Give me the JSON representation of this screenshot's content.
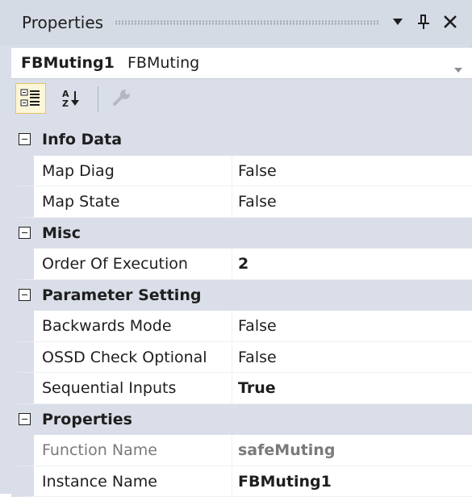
{
  "titlebar": {
    "title": "Properties",
    "icons": [
      "dropdown-arrow-icon",
      "pin-icon",
      "close-icon"
    ]
  },
  "selector": {
    "name": "FBMuting1",
    "type": "FBMuting"
  },
  "toolbar": {
    "tools": [
      "categorized-icon",
      "alphabetical-icon",
      "property-pages-icon"
    ],
    "active": "categorized"
  },
  "categories": [
    {
      "label": "Info Data",
      "properties": [
        {
          "name": "Map Diag",
          "value": "False"
        },
        {
          "name": "Map State",
          "value": "False"
        }
      ]
    },
    {
      "label": "Misc",
      "properties": [
        {
          "name": "Order Of Execution",
          "value": "2"
        }
      ]
    },
    {
      "label": "Parameter Setting",
      "properties": [
        {
          "name": "Backwards Mode",
          "value": "False"
        },
        {
          "name": "OSSD Check Optional",
          "value": "False"
        },
        {
          "name": "Sequential Inputs",
          "value": "True"
        }
      ]
    },
    {
      "label": "Properties",
      "properties": [
        {
          "name": "Function Name",
          "value": "safeMuting"
        },
        {
          "name": "Instance Name",
          "value": "FBMuting1"
        }
      ]
    }
  ],
  "colors": {
    "panel_background": "#d9dee8",
    "active_tool_background": "#fcf6d9",
    "active_tool_border": "#e5c365",
    "readonly_text": "#7a7a7a"
  }
}
